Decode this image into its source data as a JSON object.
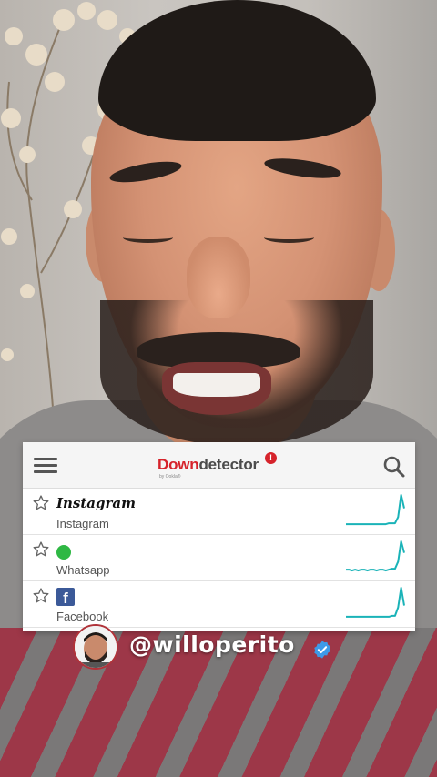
{
  "header": {
    "logo_down": "Down",
    "logo_detector": "detector",
    "logo_badge": "!",
    "logo_sub": "by Ookla®"
  },
  "services": [
    {
      "logo_text": "Instagram",
      "name": "Instagram",
      "trend": [
        2,
        2,
        2,
        2,
        2,
        2,
        2,
        2,
        2,
        2,
        2,
        2,
        2,
        2,
        3,
        3,
        3,
        10,
        35,
        20
      ]
    },
    {
      "logo_text": "",
      "name": "Whatsapp",
      "trend": [
        3,
        3,
        2,
        3,
        2,
        3,
        3,
        2,
        3,
        3,
        2,
        3,
        3,
        2,
        3,
        4,
        4,
        12,
        35,
        22
      ]
    },
    {
      "logo_text": "f",
      "name": "Facebook",
      "trend": [
        2,
        2,
        2,
        2,
        2,
        2,
        2,
        2,
        2,
        2,
        2,
        2,
        2,
        2,
        2,
        3,
        3,
        12,
        33,
        14
      ]
    }
  ],
  "handle": {
    "username": "@willoperito"
  },
  "colors": {
    "brand_red": "#d6232b",
    "sparkline": "#1ab3b8",
    "whatsapp_green": "#2fb844",
    "facebook_blue": "#3b5998",
    "verified_blue": "#3d9ae8"
  },
  "icons": [
    "menu-icon",
    "search-icon",
    "star-icon",
    "whatsapp-icon",
    "facebook-icon",
    "verified-badge-icon"
  ]
}
